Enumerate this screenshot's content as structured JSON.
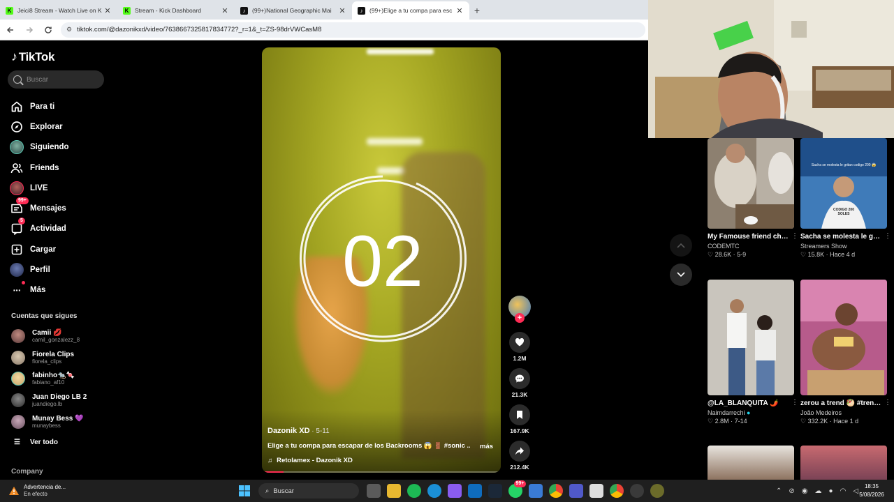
{
  "browser": {
    "tabs": [
      {
        "title": "Jeici8 Stream - Watch Live on K",
        "icon": "kick-icon",
        "active": false
      },
      {
        "title": "Stream - Kick Dashboard",
        "icon": "kick-icon",
        "active": false
      },
      {
        "title": "(99+)National Geographic Mai",
        "icon": "tiktok-icon",
        "active": false
      },
      {
        "title": "(99+)Elige a tu compa para esc",
        "icon": "tiktok-icon",
        "active": true
      }
    ],
    "url": "tiktok.com/@dazonikxd/video/7638667325817834772?_r=1&_t=ZS-98drVWCasM8"
  },
  "sidebar": {
    "logo": "TikTok",
    "search_placeholder": "Buscar",
    "nav": [
      {
        "label": "Para ti",
        "icon": "home-icon"
      },
      {
        "label": "Explorar",
        "icon": "compass-icon"
      },
      {
        "label": "Siguiendo",
        "icon": "following-avatar-icon"
      },
      {
        "label": "Friends",
        "icon": "friends-icon"
      },
      {
        "label": "LIVE",
        "icon": "live-icon"
      },
      {
        "label": "Mensajes",
        "icon": "messages-icon",
        "badge": "99+"
      },
      {
        "label": "Actividad",
        "icon": "activity-icon",
        "badge": "5"
      },
      {
        "label": "Cargar",
        "icon": "upload-icon"
      },
      {
        "label": "Perfil",
        "icon": "profile-icon"
      },
      {
        "label": "Más",
        "icon": "more-icon"
      }
    ],
    "following_title": "Cuentas que sigues",
    "following": [
      {
        "name": "Camii 💋",
        "handle": "camil_gonzalezz_8",
        "color": "#5a3a3a"
      },
      {
        "name": "Fiorela Clips",
        "handle": "fiorela_clips",
        "color": "#8a7a6a"
      },
      {
        "name": "fabinho🐀🍬",
        "handle": "fabiano_af10",
        "color": "#c9a66b"
      },
      {
        "name": "Juan Diego LB 2",
        "handle": "juandiego.lb",
        "color": "#3a3a3a"
      },
      {
        "name": "Munay Bess 💜",
        "handle": "munaybess",
        "color": "#6a5060"
      }
    ],
    "ver_todo": "Ver todo",
    "company": "Company"
  },
  "video": {
    "countdown": "02",
    "author": "Dazonik XD",
    "date": " · 5-11",
    "description": "Elige a tu compa para escapar de los Backrooms 😱 🚪 #sonic ...",
    "more": "más",
    "music": "Retolamex - Dazonik XD",
    "progress": 0.09
  },
  "actions": {
    "likes": "1.2M",
    "comments": "21.3K",
    "saves": "167.9K",
    "shares": "212.4K"
  },
  "recommendations": [
    {
      "title": "My Famouse friend challenged me to test...",
      "author": "CODEMTC",
      "stats": "♡ 28.6K · 5-9",
      "thumb_color": "#9a8c7a"
    },
    {
      "title": "Sacha se molesta le gritan codigo 😱 ...",
      "author": "Streamers Show",
      "stats": "♡ 15.8K · Hace 4 d",
      "thumb_color": "#2a5fa0",
      "thumb_text": "CODIGO 200 SOLES",
      "thumb_caption": "Sacha se molesta le gritan codigo 200 😱"
    },
    {
      "title": "@LA_BLANQUITA 🌶️",
      "author": "Naimdarrechi",
      "verified": true,
      "stats": "♡ 2.8M · 7-14",
      "thumb_color": "#c7c3bb"
    },
    {
      "title": "zerou a trend 🥙 #trend #comida #fyp",
      "author": "João Medeiros",
      "stats": "♡ 332.2K · Hace 1 d",
      "thumb_color": "#b85a8a"
    }
  ],
  "taskbar": {
    "warning_title": "Advertencia de...",
    "warning_sub": "En efecto",
    "search": "Buscar",
    "badge": "99+",
    "time": "18:35",
    "date": "5/08/2026"
  },
  "colors": {
    "accent": "#fe2c55",
    "kick": "#53fc18"
  }
}
